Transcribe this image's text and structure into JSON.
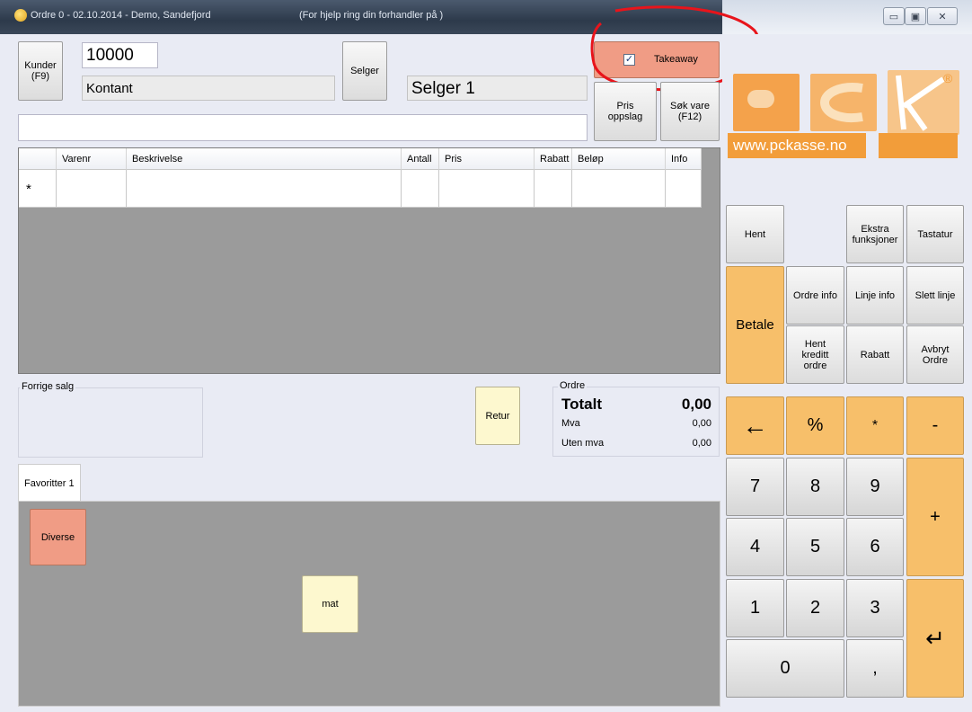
{
  "window": {
    "title": "Ordre 0 - 02.10.2014 - Demo, Sandefjord",
    "help": "(For hjelp ring din forhandler  på )",
    "min_label": "▭",
    "max_label": "▣",
    "close_label": "✕"
  },
  "customer": {
    "button_label": "Kunder\n(F9)",
    "number": "10000",
    "name": "Kontant"
  },
  "seller": {
    "button_label": "Selger",
    "name": "Selger 1"
  },
  "takeaway": {
    "label": "Takeaway",
    "checked": true,
    "check_glyph": "✓"
  },
  "toolbar": {
    "price_lookup": "Pris\noppslag",
    "search_item": "Søk vare\n(F12)"
  },
  "order_grid": {
    "columns": [
      "Varenr",
      "Beskrivelse",
      "Antall",
      "Pris",
      "Rabatt",
      "Beløp",
      "Info"
    ],
    "new_row_marker": "*"
  },
  "previous_sale": {
    "title": "Forrige salg"
  },
  "return_button": "Retur",
  "order_summary": {
    "group_title": "Ordre",
    "total_label": "Totalt",
    "total_value": "0,00",
    "vat_label": "Mva",
    "vat_value": "0,00",
    "excl_vat_label": "Uten mva",
    "excl_vat_value": "0,00"
  },
  "favorites": {
    "tab_label": "Favoritter 1",
    "buttons": [
      "Diverse",
      "mat"
    ]
  },
  "logo": {
    "url": "www.pckasse.no",
    "registered": "®"
  },
  "functions": {
    "hent": "Hent",
    "ekstra": "Ekstra\nfunksjoner",
    "tastatur": "Tastatur",
    "betale": "Betale",
    "ordre_info": "Ordre info",
    "linje_info": "Linje info",
    "slett_linje": "Slett linje",
    "hent_kreditt": "Hent\nkreditt\nordre",
    "rabatt": "Rabatt",
    "avbryt": "Avbryt\nOrdre"
  },
  "keypad": {
    "back": "←",
    "percent": "%",
    "multiply": "*",
    "minus": "-",
    "plus": "+",
    "enter": "↵",
    "comma": ",",
    "k7": "7",
    "k8": "8",
    "k9": "9",
    "k4": "4",
    "k5": "5",
    "k6": "6",
    "k1": "1",
    "k2": "2",
    "k3": "3",
    "k0": "0"
  },
  "colors": {
    "orange": "#f7bf6a",
    "salmon": "#f09c85",
    "cream": "#fdf8cf",
    "brand": "#f29d3a",
    "annotation": "#e8141b"
  }
}
